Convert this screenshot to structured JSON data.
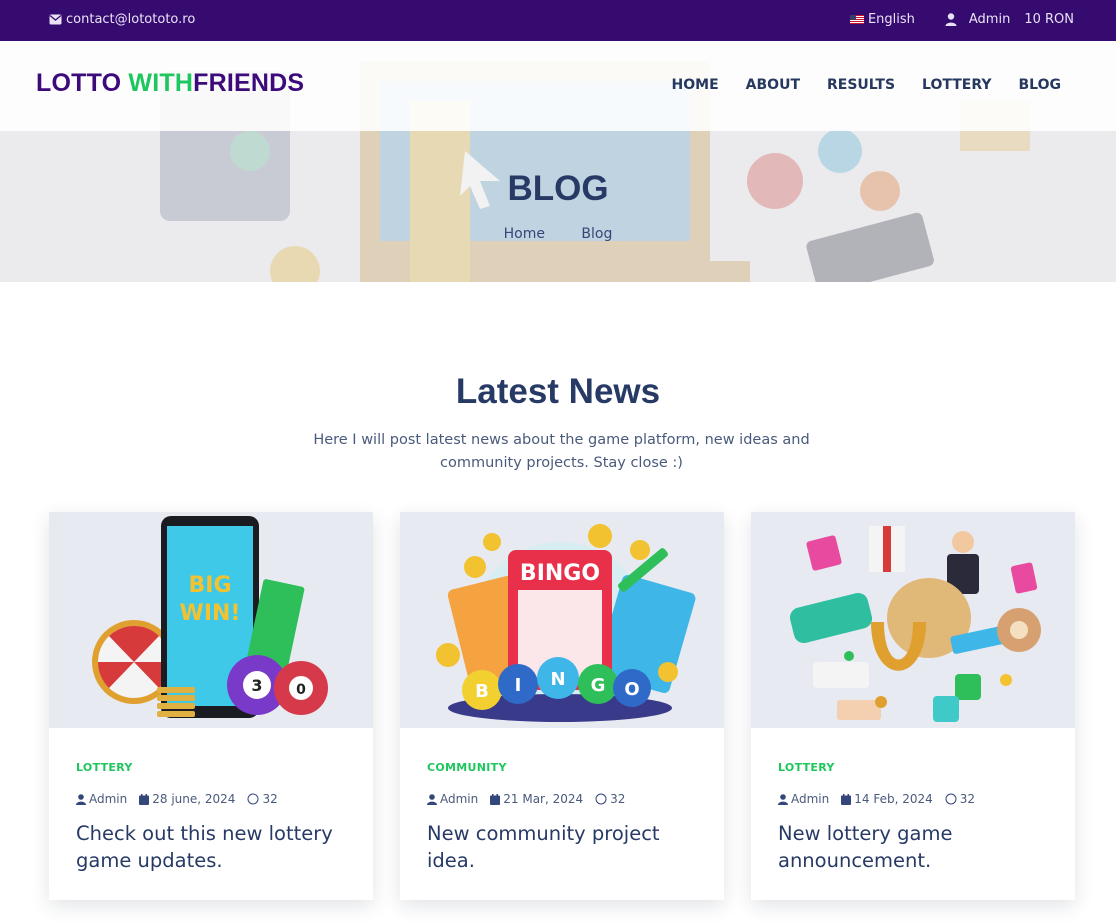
{
  "topbar": {
    "email": "contact@lotototo.ro",
    "language": "English",
    "user": "Admin",
    "balance": "10 RON"
  },
  "logo": {
    "part1": "LOTTO",
    "part2": "WITH",
    "part3": "FRIENDS"
  },
  "nav": {
    "items": [
      "HOME",
      "ABOUT",
      "RESULTS",
      "LOTTERY",
      "BLOG"
    ]
  },
  "hero": {
    "title": "BLOG",
    "breadcrumb": [
      "Home",
      "Blog"
    ]
  },
  "section": {
    "title": "Latest News",
    "description": "Here I will post latest news about the game platform, new ideas and community projects. Stay close :)"
  },
  "posts": [
    {
      "category": "LOTTERY",
      "author": "Admin",
      "date": "28 june, 2024",
      "comments": "32",
      "title": "Check out this new lottery game updates.",
      "image_icon": "big-win-phone-illustration"
    },
    {
      "category": "COMMUNITY",
      "author": "Admin",
      "date": "21 Mar, 2024",
      "comments": "32",
      "title": "New community project idea.",
      "image_icon": "bingo-illustration"
    },
    {
      "category": "LOTTERY",
      "author": "Admin",
      "date": "14 Feb, 2024",
      "comments": "32",
      "title": "New lottery game announcement.",
      "image_icon": "lottery-prizes-illustration"
    }
  ],
  "colors": {
    "topbar": "#360b6f",
    "accent_green": "#1ec75e",
    "heading": "#273a66",
    "logo_purple": "#3c0a7a"
  }
}
